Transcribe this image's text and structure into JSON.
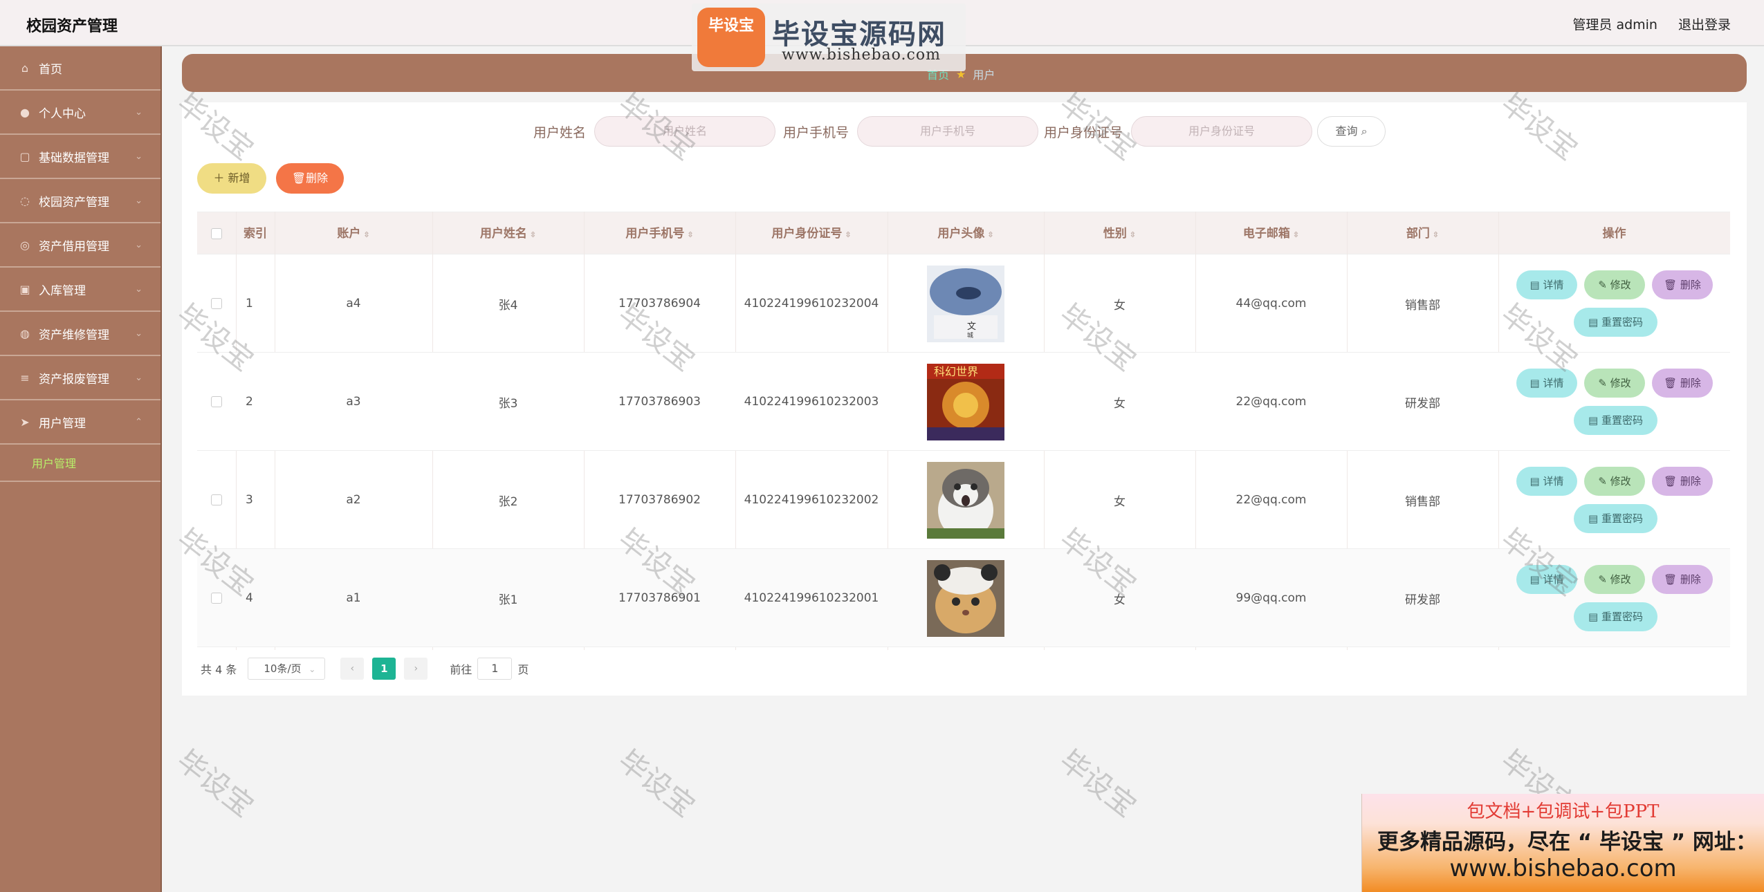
{
  "app": {
    "title": "校园资产管理",
    "user_label": "管理员 admin",
    "logout": "退出登录"
  },
  "sidebar": {
    "items": [
      {
        "label": "首页",
        "icon": "home-icon"
      },
      {
        "label": "个人中心",
        "icon": "user-icon"
      },
      {
        "label": "基础数据管理",
        "icon": "data-icon"
      },
      {
        "label": "校园资产管理",
        "icon": "asset-icon"
      },
      {
        "label": "资产借用管理",
        "icon": "borrow-icon"
      },
      {
        "label": "入库管理",
        "icon": "storage-icon"
      },
      {
        "label": "资产维修管理",
        "icon": "repair-icon"
      },
      {
        "label": "资产报废管理",
        "icon": "scrap-icon"
      },
      {
        "label": "用户管理",
        "icon": "send-icon"
      }
    ],
    "sub_item": "用户管理"
  },
  "breadcrumb": {
    "home": "首页",
    "current": "用户"
  },
  "search": {
    "name_label": "用户姓名",
    "name_placeholder": "用户姓名",
    "phone_label": "用户手机号",
    "phone_placeholder": "用户手机号",
    "id_label": "用户身份证号",
    "id_placeholder": "用户身份证号",
    "query": "查询"
  },
  "actions": {
    "add": "新增",
    "delete": "删除"
  },
  "table": {
    "headers": [
      "索引",
      "账户",
      "用户姓名",
      "用户手机号",
      "用户身份证号",
      "用户头像",
      "性别",
      "电子邮箱",
      "部门",
      "操作"
    ],
    "rows": [
      {
        "idx": "1",
        "account": "a4",
        "name": "张4",
        "phone": "17703786904",
        "idcard": "410224199610232004",
        "gender": "女",
        "email": "44@qq.com",
        "dept": "销售部"
      },
      {
        "idx": "2",
        "account": "a3",
        "name": "张3",
        "phone": "17703786903",
        "idcard": "410224199610232003",
        "gender": "女",
        "email": "22@qq.com",
        "dept": "研发部"
      },
      {
        "idx": "3",
        "account": "a2",
        "name": "张2",
        "phone": "17703786902",
        "idcard": "410224199610232002",
        "gender": "女",
        "email": "22@qq.com",
        "dept": "销售部"
      },
      {
        "idx": "4",
        "account": "a1",
        "name": "张1",
        "phone": "17703786901",
        "idcard": "410224199610232001",
        "gender": "女",
        "email": "99@qq.com",
        "dept": "研发部"
      }
    ],
    "ops": {
      "detail": "详情",
      "edit": "修改",
      "remove": "删除",
      "reset": "重置密码"
    }
  },
  "pagination": {
    "total": "共 4 条",
    "size": "10条/页",
    "current": "1",
    "goto": "前往",
    "goto_value": "1",
    "page_unit": "页"
  },
  "watermark": {
    "text": "毕设宝"
  },
  "logo": {
    "badge": "毕设宝",
    "name": "毕设宝源码网",
    "url": "www.bishebao.com"
  },
  "ad": {
    "line1": "包文档+包调试+包PPT",
    "line2": "更多精品源码，尽在 “ 毕设宝 ” 网址：",
    "line3": "www.bishebao.com"
  }
}
